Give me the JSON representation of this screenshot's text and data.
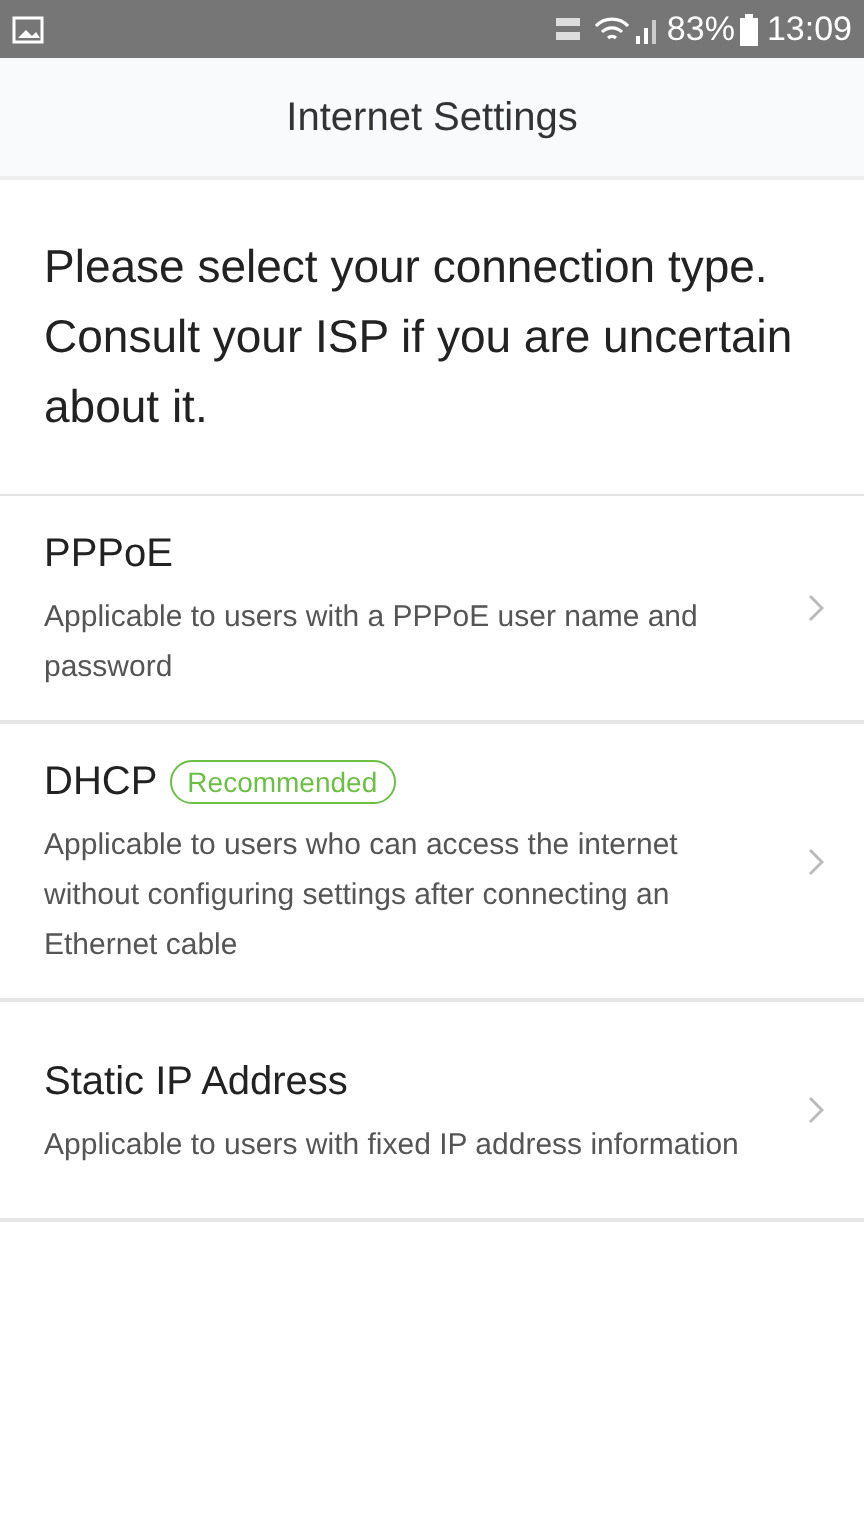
{
  "status_bar": {
    "battery": "83%",
    "time": "13:09"
  },
  "header": {
    "title": "Internet Settings"
  },
  "intro": "Please select your connection type. Consult your ISP if you are uncertain about it.",
  "options": [
    {
      "title": "PPPoE",
      "description": "Applicable to users with a PPPoE user name and password"
    },
    {
      "title": "DHCP",
      "badge": "Recommended",
      "description": "Applicable to users who can access the internet without configuring settings after connecting an Ethernet cable"
    },
    {
      "title": "Static IP Address",
      "description": "Applicable to users with fixed IP address information"
    }
  ]
}
